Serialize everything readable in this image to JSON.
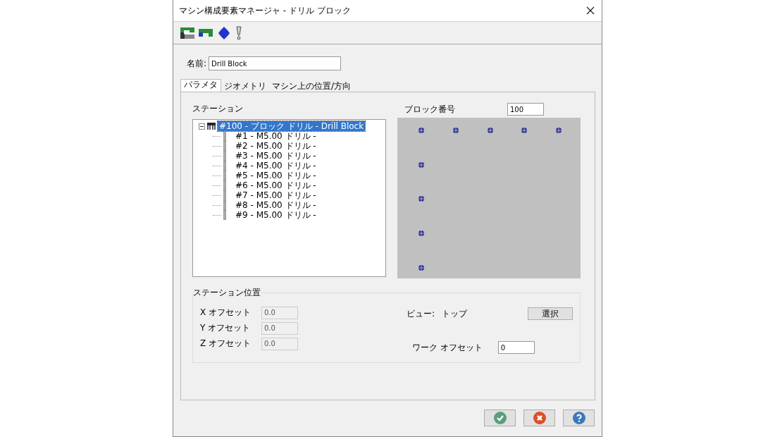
{
  "window": {
    "title": "マシン構成要素マネージャ - ドリル ブロック"
  },
  "name_field": {
    "label": "名前:",
    "value": "Drill Block"
  },
  "tabs": [
    {
      "label": "パラメタ",
      "selected": true
    },
    {
      "label": "ジオメトリ",
      "selected": false
    },
    {
      "label": "マシン上の位置/方向",
      "selected": false
    }
  ],
  "station_label": "ステーション",
  "tree": {
    "label": "#100 - ブロック ドリル - Drill Block",
    "selected": true,
    "expanded": true,
    "children": [
      {
        "label": "#1 - M5.00 ドリル -",
        "selected": false
      },
      {
        "label": "#2 - M5.00 ドリル -",
        "selected": false
      },
      {
        "label": "#3 - M5.00 ドリル -",
        "selected": false
      },
      {
        "label": "#4 - M5.00 ドリル -",
        "selected": false
      },
      {
        "label": "#5 - M5.00 ドリル -",
        "selected": false
      },
      {
        "label": "#6 - M5.00 ドリル -",
        "selected": false
      },
      {
        "label": "#7 - M5.00 ドリル -",
        "selected": false
      },
      {
        "label": "#8 - M5.00 ドリル -",
        "selected": false
      },
      {
        "label": "#9 - M5.00 ドリル -",
        "selected": false
      }
    ]
  },
  "block_number": {
    "label": "ブロック番号",
    "value": "100"
  },
  "station_position": {
    "title": "ステーション位置",
    "offsets": [
      {
        "label": "X オフセット",
        "value": "0.0",
        "disabled": true
      },
      {
        "label": "Y オフセット",
        "value": "0.0",
        "disabled": true
      },
      {
        "label": "Z オフセット",
        "value": "0.0",
        "disabled": true
      }
    ],
    "view_label": "ビュー:",
    "view_value": "トップ",
    "select_button": "選択",
    "work_offset": {
      "label": "ワーク オフセット",
      "value": "0"
    }
  },
  "buttons": [
    {
      "kind": "ok"
    },
    {
      "kind": "cancel"
    },
    {
      "kind": "help"
    }
  ]
}
